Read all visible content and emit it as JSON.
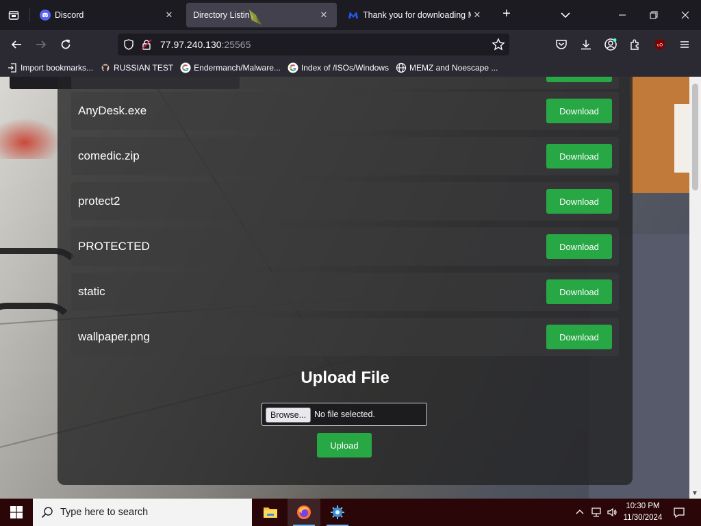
{
  "tabs": [
    {
      "title": "Discord",
      "icon": "discord-icon"
    },
    {
      "title": "Directory Listin",
      "icon": "",
      "active": true
    },
    {
      "title": "Thank you for downloading Ma",
      "icon": "malwarebytes-icon"
    }
  ],
  "address": {
    "host": "77.97.240.130",
    "port": ":25565"
  },
  "bookmarks": [
    {
      "label": "Import bookmarks...",
      "icon": "import-icon"
    },
    {
      "label": "RUSSIAN TEST",
      "icon": "github-icon"
    },
    {
      "label": "Endermanch/Malware...",
      "icon": "google-icon"
    },
    {
      "label": "Index of /ISOs/Windows",
      "icon": "google-icon"
    },
    {
      "label": "MEMZ and Noescape ...",
      "icon": "globe-icon"
    }
  ],
  "files": [
    {
      "name": "AnyDesk.exe",
      "button": "Download"
    },
    {
      "name": "comedic.zip",
      "button": "Download"
    },
    {
      "name": "protect2",
      "button": "Download"
    },
    {
      "name": "PROTECTED",
      "button": "Download"
    },
    {
      "name": "static",
      "button": "Download"
    },
    {
      "name": "wallpaper.png",
      "button": "Download"
    }
  ],
  "upload": {
    "title": "Upload File",
    "browse_label": "Browse...",
    "file_status": "No file selected.",
    "button": "Upload"
  },
  "taskbar": {
    "search_placeholder": "Type here to search",
    "time": "10:30 PM",
    "date": "11/30/2024"
  },
  "colors": {
    "accent_green": "#28a745",
    "browser_dark": "#1c1b22",
    "toolbar": "#2b2a33",
    "taskbar": "#2b0608"
  }
}
